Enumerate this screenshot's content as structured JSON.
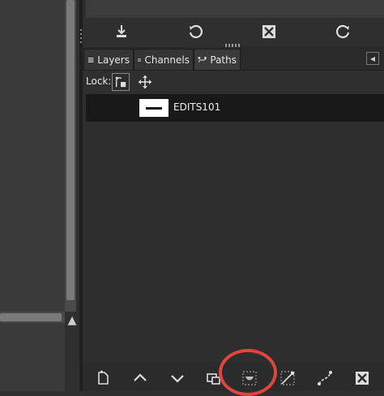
{
  "tabs": [
    {
      "label": "Layers",
      "icon": "layers-icon"
    },
    {
      "label": "Channels",
      "icon": "channels-icon"
    },
    {
      "label": "Paths",
      "icon": "paths-icon",
      "active": true
    }
  ],
  "lock": {
    "label": "Lock:"
  },
  "paths": [
    {
      "name": "EDITS101",
      "thumbnail": "path-thumbnail"
    }
  ],
  "top_toolbar": [
    "save-icon",
    "reset-icon",
    "delete-icon",
    "restore-icon"
  ],
  "bottom_toolbar": [
    "new-path-icon",
    "raise-icon",
    "lower-icon",
    "duplicate-icon",
    "path-to-selection-icon",
    "selection-to-path-icon",
    "paint-along-path-icon",
    "delete-path-icon"
  ],
  "colors": {
    "highlight_ring": "#e0463c",
    "row_selected": "#191919"
  }
}
